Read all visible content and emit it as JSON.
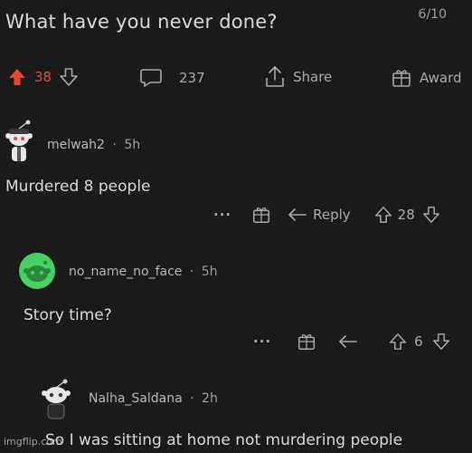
{
  "post": {
    "title": "What have you never done?",
    "page_indicator": "6/10",
    "votes": "38",
    "comments": "237",
    "share_label": "Share",
    "award_label": "Award"
  },
  "comments": [
    {
      "username": "melwah2",
      "age": "5h",
      "text": "Murdered 8 people",
      "more": "···",
      "reply_label": "Reply",
      "votes": "28"
    },
    {
      "username": "no_name_no_face",
      "age": "5h",
      "text": "Story time?",
      "more": "···",
      "votes": "6"
    },
    {
      "username": "Nalha_Saldana",
      "age": "2h",
      "text": "So I was sitting at home not murdering people"
    }
  ],
  "separator": "·",
  "watermark": "imgflip.com",
  "colors": {
    "background": "#1b1b1c",
    "upvote_active": "#e8452c",
    "text": "#d7dadc",
    "muted": "#a8aaac",
    "avatar_green": "#46d160"
  }
}
